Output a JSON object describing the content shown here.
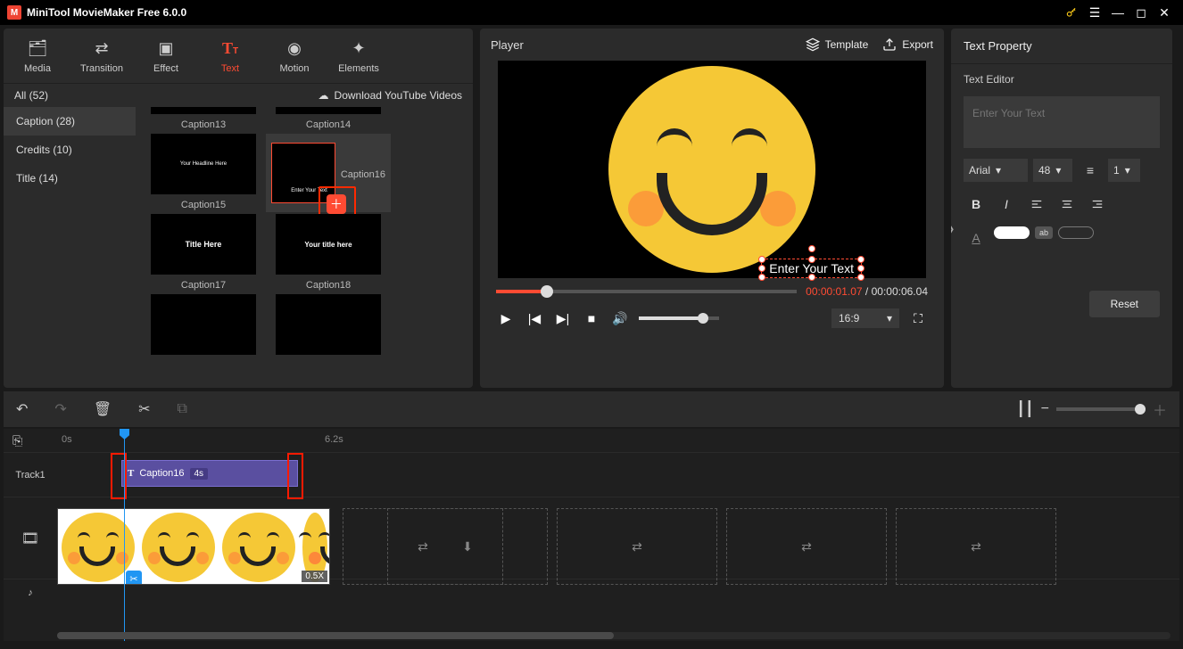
{
  "app": {
    "title": "MiniTool MovieMaker Free 6.0.0"
  },
  "toolbar": [
    {
      "id": "media",
      "label": "Media"
    },
    {
      "id": "transition",
      "label": "Transition"
    },
    {
      "id": "effect",
      "label": "Effect"
    },
    {
      "id": "text",
      "label": "Text"
    },
    {
      "id": "motion",
      "label": "Motion"
    },
    {
      "id": "elements",
      "label": "Elements"
    }
  ],
  "library": {
    "all_label": "All (52)",
    "download_label": "Download YouTube Videos",
    "categories": [
      {
        "id": "caption",
        "label": "Caption (28)"
      },
      {
        "id": "credits",
        "label": "Credits (10)"
      },
      {
        "id": "title",
        "label": "Title (14)"
      }
    ],
    "thumbs": [
      {
        "id": "c13",
        "label": "Caption13",
        "inner": ""
      },
      {
        "id": "c14",
        "label": "Caption14",
        "inner": ""
      },
      {
        "id": "c15",
        "label": "Caption15",
        "inner": "Your Headline Here"
      },
      {
        "id": "c16",
        "label": "Caption16",
        "inner": "Enter Your Text",
        "selected": true,
        "showAdd": true
      },
      {
        "id": "c17",
        "label": "Caption17",
        "inner": "Title Here"
      },
      {
        "id": "c18",
        "label": "Caption18",
        "inner": "Your title here"
      }
    ]
  },
  "player": {
    "label": "Player",
    "template_btn": "Template",
    "export_btn": "Export",
    "overlay_text": "Enter Your Text",
    "time_current": "00:00:01.07",
    "time_sep": " / ",
    "time_total": "00:00:06.04",
    "ratio": "16:9"
  },
  "textprop": {
    "title": "Text Property",
    "editor_label": "Text Editor",
    "placeholder": "Enter Your Text",
    "font": "Arial",
    "size": "48",
    "line": "1",
    "reset": "Reset",
    "text_color": "#ffffff",
    "highlight_color": "#888888"
  },
  "timeline": {
    "t0": "0s",
    "t1": "6.2s",
    "track1_label": "Track1",
    "caption_clip": {
      "name": "Caption16",
      "dur": "4s"
    },
    "speed_badge": "0.5X"
  }
}
